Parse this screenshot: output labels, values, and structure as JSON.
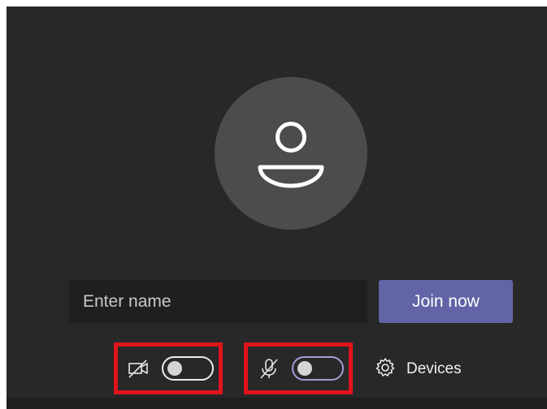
{
  "prejoin": {
    "name_input": {
      "placeholder": "Enter name",
      "value": ""
    },
    "join_button": {
      "label": "Join now"
    },
    "video": {
      "icon": "video-off-icon",
      "toggle_on": false
    },
    "audio": {
      "icon": "mic-off-icon",
      "toggle_on": false
    },
    "devices": {
      "icon": "gear-icon",
      "label": "Devices"
    }
  },
  "colors": {
    "background": "#292828",
    "avatar_bg": "#4d4c4c",
    "input_bg": "#1f1f1f",
    "accent": "#6264a7",
    "highlight_box": "#e0141c"
  }
}
